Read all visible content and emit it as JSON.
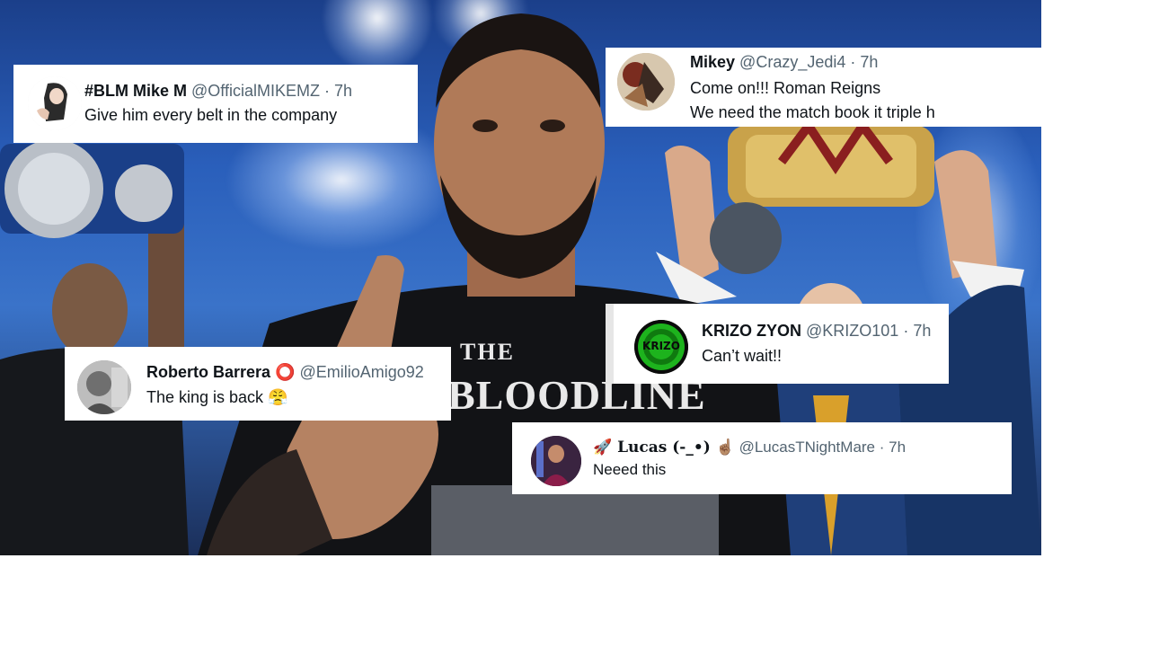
{
  "tweets": [
    {
      "name": "#BLM Mike M",
      "handle": "@OfficialMIKEMZ · 7h",
      "lines": [
        "Give him every belt in the company"
      ],
      "avatar_icon": "anime-character-avatar"
    },
    {
      "name": "Mikey",
      "handle": "@Crazy_Jedi4 · 7h",
      "lines": [
        "Come on!!! Roman Reigns",
        "We need the match book it triple h"
      ],
      "avatar_icon": "artwork-avatar"
    },
    {
      "name": "KRIZO ZYON",
      "handle": "@KRIZO101 · 7h",
      "lines": [
        "Can’t wait!!"
      ],
      "avatar_icon": "krizo-logo-avatar",
      "avatar_text": "KRIZO"
    },
    {
      "name": "Roberto Barrera",
      "name_suffix": "⭕",
      "handle": "@EmilioAmigo92",
      "lines": [
        "The king is back",
        "😤"
      ],
      "avatar_icon": "portrait-avatar"
    },
    {
      "name": "🚀 Lucas (-_•) ☝🏽",
      "handle": "@LucasTNightMare · 7h",
      "lines": [
        "Neeed this"
      ],
      "avatar_icon": "wrestler-avatar"
    }
  ],
  "scene": {
    "shirt_text": "THE BLOODLINE",
    "colors": {
      "tweet_bg": "#ffffff",
      "name": "#0f1419",
      "handle": "#536471",
      "stage_blue": "#2a5fbb",
      "krizo_green": "#1db31d"
    }
  }
}
